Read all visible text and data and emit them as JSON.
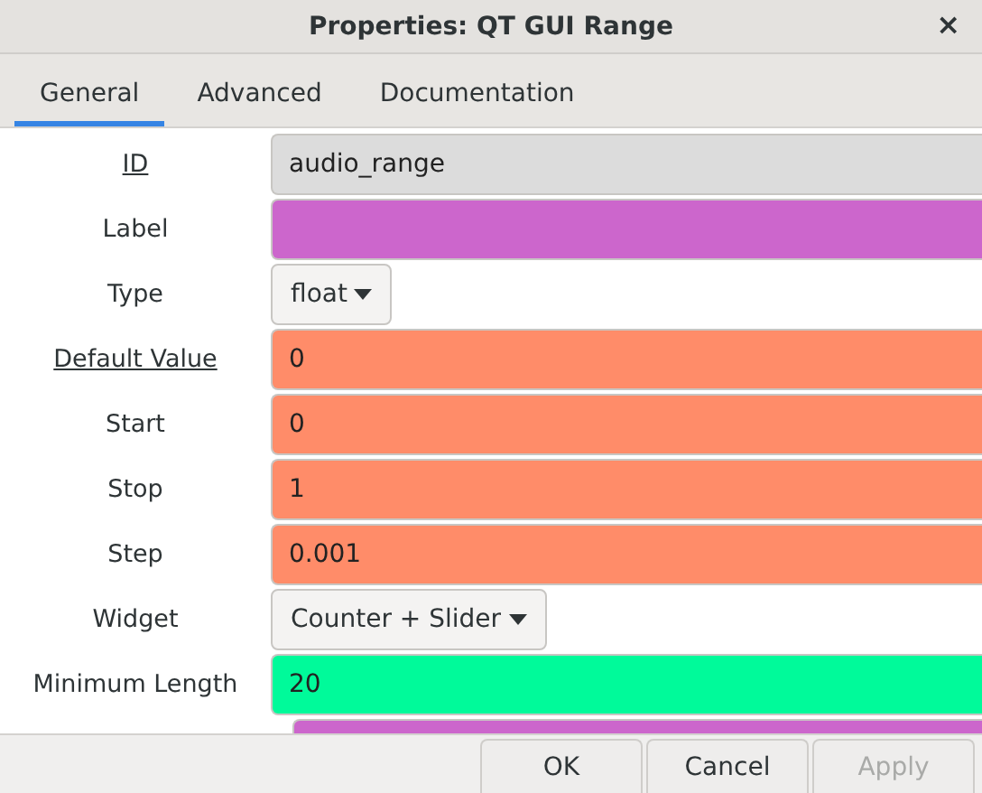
{
  "window": {
    "title": "Properties: QT GUI Range",
    "close": "×"
  },
  "tabs": [
    {
      "label": "General",
      "selected": true
    },
    {
      "label": "Advanced",
      "selected": false
    },
    {
      "label": "Documentation",
      "selected": false
    }
  ],
  "fields": [
    {
      "label": "ID",
      "underlined": true,
      "kind": "text",
      "value": "audio_range",
      "color": "#dcdcdc"
    },
    {
      "label": "Label",
      "underlined": false,
      "kind": "text",
      "color": "#cc66cc"
    },
    {
      "label": "Type",
      "underlined": false,
      "kind": "dropdown",
      "value": "float"
    },
    {
      "label": "Default Value",
      "underlined": true,
      "kind": "text",
      "value": "0",
      "color": "#ff8c69"
    },
    {
      "label": "Start",
      "underlined": false,
      "kind": "text",
      "value": "0",
      "color": "#ff8c69"
    },
    {
      "label": "Stop",
      "underlined": false,
      "kind": "text",
      "value": "1",
      "color": "#ff8c69"
    },
    {
      "label": "Step",
      "underlined": false,
      "kind": "text",
      "value": "0.001",
      "color": "#ff8c69"
    },
    {
      "label": "Widget",
      "underlined": false,
      "kind": "dropdown",
      "value": "Counter + Slider"
    },
    {
      "label": "Minimum Length",
      "underlined": false,
      "kind": "text",
      "value": "20",
      "color": "#00fa9a"
    }
  ],
  "partial_field": {
    "color": "#cc66cc"
  },
  "buttons": [
    {
      "label": "OK",
      "disabled": false
    },
    {
      "label": "Cancel",
      "disabled": false
    },
    {
      "label": "Apply",
      "disabled": true
    }
  ]
}
